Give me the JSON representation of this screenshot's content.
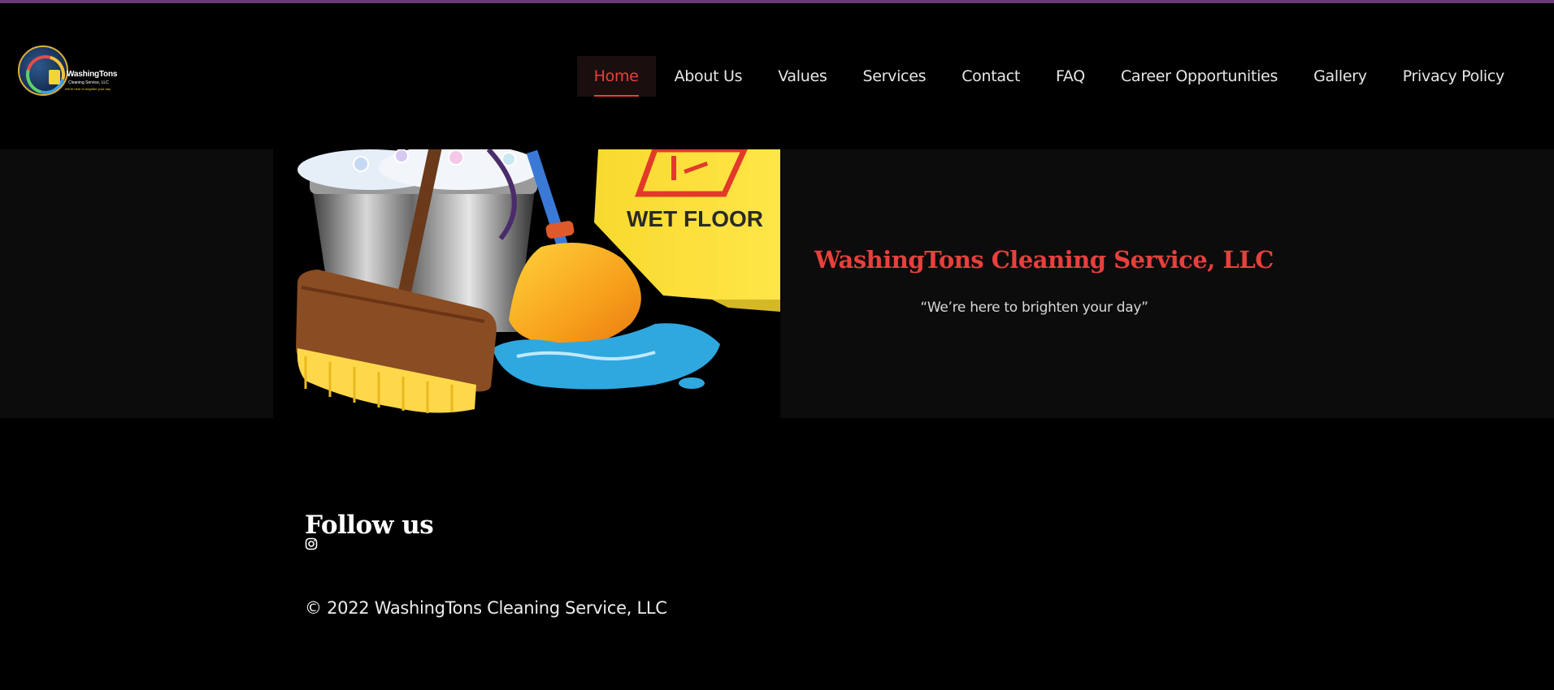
{
  "colors": {
    "accent": "#e8403c",
    "top_bar": "#6b3a78",
    "background": "#000000",
    "hero_band": "#0c0c0c"
  },
  "header": {
    "logo": {
      "brand": "WashingTons",
      "sub": "Cleaning Service, LLC",
      "tagline": "We're here to brighten your day",
      "icon": "washingtons-logo"
    },
    "nav": [
      {
        "label": "Home",
        "active": true
      },
      {
        "label": "About Us",
        "active": false
      },
      {
        "label": "Values",
        "active": false
      },
      {
        "label": "Services",
        "active": false
      },
      {
        "label": "Contact",
        "active": false
      },
      {
        "label": "FAQ",
        "active": false
      },
      {
        "label": "Career Opportunities",
        "active": false
      },
      {
        "label": "Gallery",
        "active": false
      },
      {
        "label": "Privacy Policy",
        "active": false
      }
    ]
  },
  "hero": {
    "image_sign_text": "WET FLOOR",
    "title": "WashingTons Cleaning Service, LLC",
    "tagline": "“We’re here to brighten your day”"
  },
  "footer": {
    "heading": "Follow us",
    "social_icon": "instagram-icon",
    "copyright": "© 2022 WashingTons Cleaning Service, LLC"
  }
}
